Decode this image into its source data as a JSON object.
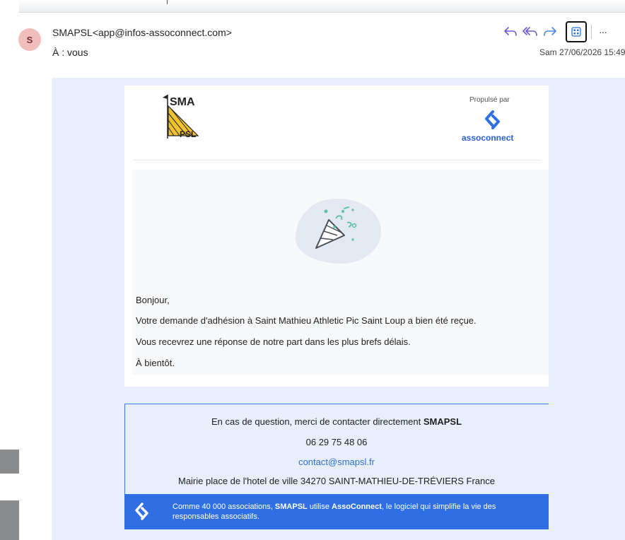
{
  "header": {
    "avatar_letter": "S",
    "sender": "SMAPSL<app@infos-assoconnect.com>",
    "to": "À : vous",
    "date": "Sam 27/06/2026 15:49",
    "actions": [
      "reply-icon",
      "reply-all-icon",
      "forward-icon",
      "apps-icon",
      "more-icon"
    ]
  },
  "logo": {
    "top_text": "SMA",
    "bottom_text": "PSL"
  },
  "partner": {
    "powered_by": "Propulsé par",
    "name": "assoconnect"
  },
  "body": {
    "greeting": "Bonjour,",
    "line1": "Votre demande d'adhésion à Saint Mathieu Athletic Pic Saint Loup a bien été reçue.",
    "line2": "Vous recevrez une réponse de notre part dans les plus brefs délais.",
    "closing": "À bientôt."
  },
  "footer": {
    "contact_prefix": "En cas de question, merci de contacter directement",
    "contact_org": "SMAPSL",
    "phone": "06 29 75 48 06",
    "email": "contact@smapsl.fr",
    "address": "Mairie place de l'hotel de ville 34270 SAINT-MATHIEU-DE-TRÉVIERS France",
    "banner_prefix": "Comme 40 000 associations,",
    "banner_org": "SMAPSL",
    "banner_mid": "utilise",
    "banner_brand": "AssoConnect",
    "banner_suffix": ", le logiciel qui simplifie la vie des responsables associatifs."
  },
  "colors": {
    "accent": "#2e6fe6",
    "mail_background": "#e8eefc",
    "avatar": "#f2bdbd"
  }
}
